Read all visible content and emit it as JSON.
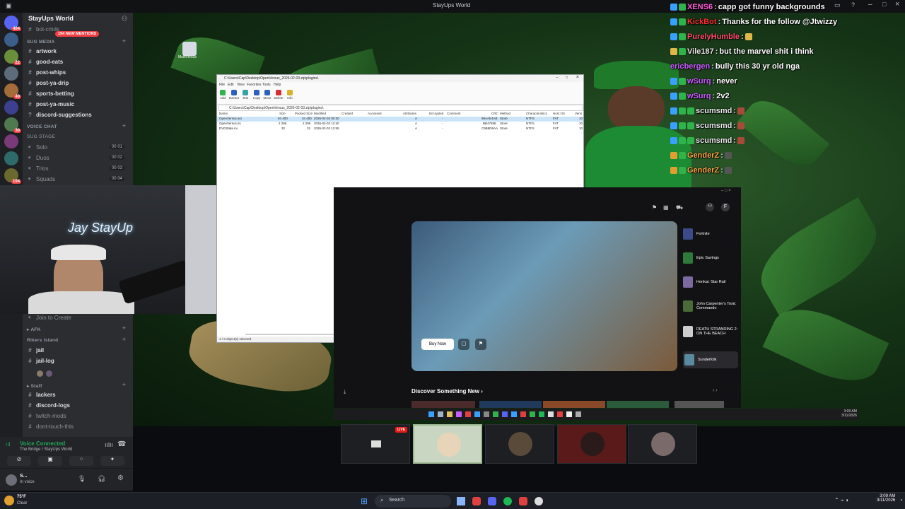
{
  "app": {
    "title": "StayUps World"
  },
  "server": {
    "name": "StayUps World",
    "mentions_label": "194 NEW MENTIONS",
    "rail_badges": [
      "404",
      "22",
      "40",
      "30",
      "194"
    ]
  },
  "sidebar": {
    "top_channel": "bot-cmds",
    "categories": [
      {
        "label": "SUG MEDIA"
      },
      {
        "label": "VOICE CHAT"
      },
      {
        "label": "SUG STAGE"
      }
    ],
    "text_channels": [
      {
        "label": "artwork"
      },
      {
        "label": "good-eats"
      },
      {
        "label": "post-whips"
      },
      {
        "label": "post-ya-drip"
      },
      {
        "label": "sports-betting"
      },
      {
        "label": "post-ya-music"
      },
      {
        "label": "discord-suggestions"
      }
    ],
    "voice_channels": [
      {
        "label": "Solo",
        "count": "00",
        "limit": "01"
      },
      {
        "label": "Duos",
        "count": "00",
        "limit": "02"
      },
      {
        "label": "Trios",
        "count": "00",
        "limit": "03"
      },
      {
        "label": "Squads",
        "count": "00",
        "limit": "04"
      }
    ],
    "lower": {
      "join_to_create": "Join to Create",
      "afk": "AFK",
      "rikers": "Rikers Island",
      "jail": "jail",
      "jail_log": "jail-log",
      "staff": "Staff",
      "lackers": "lackers",
      "discord_logs": "discord-logs",
      "twitch_mods": "twitch-mods",
      "dont_touch": "dont-touch-this"
    }
  },
  "voice": {
    "status": "Voice Connected",
    "location": "The Bridge / StayUps World"
  },
  "user": {
    "name": "S...",
    "status": "In voice"
  },
  "explorer": {
    "title": "C:\\Users\\Cap\\Desktop\\OpenVersus_2026-02-03.zip\\plugins\\",
    "menu": [
      "File",
      "Edit",
      "View",
      "Favorites",
      "Tools",
      "Help"
    ],
    "tools": [
      "Add",
      "Extract",
      "Test",
      "Copy",
      "Move",
      "Delete",
      "Info"
    ],
    "address": "C:\\Users\\Cap\\Desktop\\OpenVersus_2026-02-03.zip\\plugins\\",
    "columns": [
      "Name",
      "Size",
      "Packed Size",
      "Modified",
      "Created",
      "Accessed",
      "Attributes",
      "Encrypted",
      "Comment",
      "CRC",
      "Method",
      "Characteristics",
      "Host OS",
      "Versi"
    ],
    "rows": [
      {
        "name": "OpenVersus.asi",
        "size": "94 400",
        "packed": "34 400",
        "modified": "2026-02-03 00:30",
        "attr": "A",
        "enc": "-",
        "crc": "98AAE4AB",
        "method": "Store",
        "chars": "NTFS",
        "host": "FAT",
        "ver": "10"
      },
      {
        "name": "OpenVersus.ini",
        "size": "2 296",
        "packed": "2 296",
        "modified": "2026-02-03 12:30",
        "attr": "A",
        "enc": "-",
        "crc": "BB47698",
        "method": "Store",
        "chars": "NTFS",
        "host": "FAT",
        "ver": "10"
      },
      {
        "name": "DVDState.ini",
        "size": "32",
        "packed": "32",
        "modified": "2026-02-03 12:55",
        "attr": "A",
        "enc": "-",
        "crc": "C9B8D6AA",
        "method": "Store",
        "chars": "NTFS",
        "host": "FAT",
        "ver": "10"
      }
    ],
    "status": "1 / 3 object(s) selected"
  },
  "chat": {
    "messages": [
      {
        "user": "XENS6",
        "text": "capp got funny backgrounds",
        "color": "#ff59d6"
      },
      {
        "user": "KickBot",
        "text": "Thanks for the follow @Jtwizzy",
        "color": "#ff2e2e"
      },
      {
        "user": "PurelyHumble",
        "text": "",
        "color": "#ff4d6a"
      },
      {
        "user": "Vile187",
        "text": "but the marvel shit i think",
        "color": "#e8e8e8"
      },
      {
        "user": "ericbergen",
        "text": "bully this 30 yr old nga",
        "color": "#c75cff"
      },
      {
        "user": "wSurq",
        "text": "never",
        "color": "#c75cff"
      },
      {
        "user": "wSurq",
        "text": "2v2",
        "color": "#c75cff"
      },
      {
        "user": "scumsmd",
        "text": "",
        "color": "#e8e8e8"
      },
      {
        "user": "scumsmd",
        "text": "",
        "color": "#e8e8e8"
      },
      {
        "user": "scumsmd",
        "text": "",
        "color": "#e8e8e8"
      },
      {
        "user": "GenderZ",
        "text": "",
        "color": "#ffa63d"
      },
      {
        "user": "GenderZ",
        "text": "",
        "color": "#ffa63d"
      }
    ]
  },
  "epic": {
    "library": [
      {
        "label": "Fortnite"
      },
      {
        "label": "Epic Savings"
      },
      {
        "label": "Honkai: Star Rail"
      },
      {
        "label": "John Carpenter's Toxic Commando"
      },
      {
        "label": "DEATH STRANDING 2: ON THE BEACH"
      },
      {
        "label": "Sunderfolk"
      }
    ],
    "buy_label": "Buy Now",
    "discover": "Discover Something New",
    "avatar_letter": "F"
  },
  "thumbnails": {
    "live_label": "LIVE"
  },
  "inner_clock": {
    "time": "3:09 AM",
    "date": "3/11/2026"
  },
  "taskbar": {
    "weather_temp": "75°F",
    "weather_desc": "Clear",
    "search_placeholder": "Search",
    "time": "3:09 AM",
    "date": "3/11/2026"
  },
  "desktop": {
    "icon_label": "MultiVersus"
  },
  "colors": {
    "discord_bg": "#2b2d31",
    "rail_bg": "#1e1f22",
    "mention_red": "#f23f43",
    "voice_green": "#23a55a"
  }
}
